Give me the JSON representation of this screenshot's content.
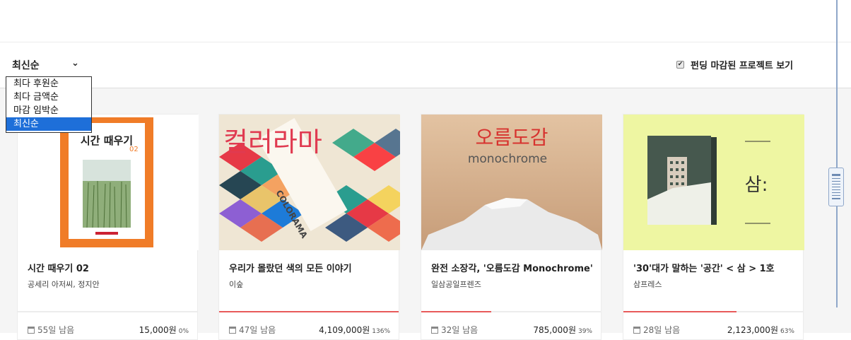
{
  "sort": {
    "selected": "최신순",
    "options": [
      "최다 후원순",
      "최다 금액순",
      "마감 임박순",
      "최신순"
    ]
  },
  "show_ended": {
    "label": "펀딩 마감된 프로젝트 보기",
    "checked": true
  },
  "projects": [
    {
      "title": "시간 때우기 02",
      "creator": "공세리 아저씨, 정지안",
      "days_left": "55",
      "days_suffix": "일 남음",
      "amount": "15,000",
      "currency": "원",
      "percent": "0%",
      "progress": 0
    },
    {
      "title": "우리가 몰랐던 색의 모든 이야기",
      "creator": "이숲",
      "days_left": "47",
      "days_suffix": "일 남음",
      "amount": "4,109,000",
      "currency": "원",
      "percent": "136%",
      "progress": 1.0
    },
    {
      "title": "완전 소장각, '오름도감 Monochrome'",
      "creator": "일삼공일프렌즈",
      "days_left": "32",
      "days_suffix": "일 남음",
      "amount": "785,000",
      "currency": "원",
      "percent": "39%",
      "progress": 0.39
    },
    {
      "title": "'30'대가 말하는 '공간' < 삼 > 1호",
      "creator": "삼프레스",
      "days_left": "28",
      "days_suffix": "일 남음",
      "amount": "2,123,000",
      "currency": "원",
      "percent": "63%",
      "progress": 0.63
    }
  ],
  "thumbs": {
    "book1": {
      "title": "시간 때우기",
      "num": "02"
    },
    "book2": {
      "text": "컬러라마",
      "brand": "COLORAMA"
    },
    "book3": {
      "title": "오름도감",
      "sub": "monochrome"
    },
    "book4": {
      "text": "삼:"
    }
  }
}
